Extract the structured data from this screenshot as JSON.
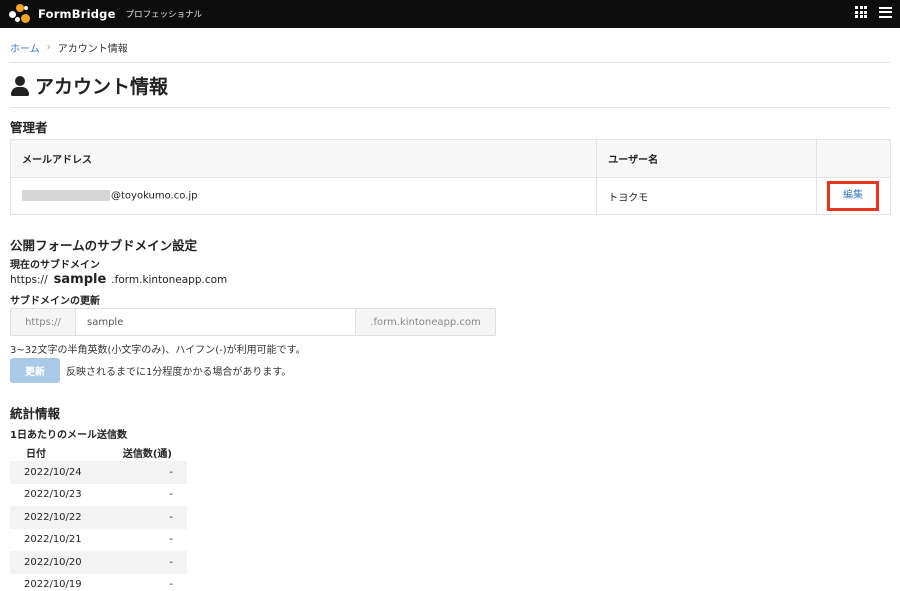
{
  "header": {
    "brand": "FormBridge",
    "edition": "プロフェッショナル",
    "logo_colors": [
      "#f5a623",
      "#ffffff"
    ],
    "icons": [
      "apps-grid-icon",
      "hamburger-menu-icon"
    ]
  },
  "breadcrumb": {
    "home": "ホーム",
    "separator": "›",
    "current": "アカウント情報"
  },
  "page": {
    "title": "アカウント情報",
    "icon": "user-icon"
  },
  "admin": {
    "section_title": "管理者",
    "columns": [
      "メールアドレス",
      "ユーザー名",
      ""
    ],
    "row": {
      "email_domain": "@toyokumo.co.jp",
      "username": "トヨクモ",
      "edit_label": "編集"
    }
  },
  "subdomain": {
    "section_title": "公開フォームのサブドメイン設定",
    "current_label": "現在のサブドメイン",
    "current_prefix": "https://",
    "current_value": "sample",
    "current_suffix": ".form.kintoneapp.com",
    "update_label": "サブドメインの更新",
    "input_prefix": "https://",
    "input_value": "sample",
    "input_suffix": ".form.kintoneapp.com",
    "hint": "3~32文字の半角英数(小文字のみ)、ハイフン(-)が利用可能です。",
    "update_button": "更新",
    "update_note": "反映されるまでに1分程度かかる場合があります。"
  },
  "stats": {
    "section_title": "統計情報",
    "subtitle": "1日あたりのメール送信数",
    "columns": [
      "日付",
      "送信数(通)"
    ],
    "rows": [
      {
        "date": "2022/10/24",
        "count": "-"
      },
      {
        "date": "2022/10/23",
        "count": "-"
      },
      {
        "date": "2022/10/22",
        "count": "-"
      },
      {
        "date": "2022/10/21",
        "count": "-"
      },
      {
        "date": "2022/10/20",
        "count": "-"
      },
      {
        "date": "2022/10/19",
        "count": "-"
      }
    ]
  },
  "colors": {
    "link": "#3b78c4",
    "highlight_border": "#e8351f",
    "button_disabled": "#a9c9e6",
    "topbar": "#0d0d0d"
  }
}
